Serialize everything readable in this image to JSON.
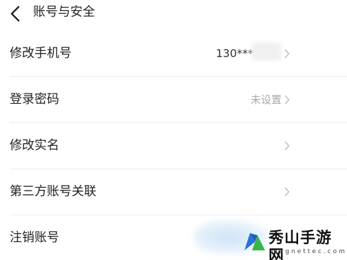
{
  "header": {
    "title": "账号与安全",
    "back_icon": "chevron-left-icon"
  },
  "rows": [
    {
      "label": "修改手机号",
      "value": "130****"
    },
    {
      "label": "登录密码",
      "value": "未设置"
    },
    {
      "label": "修改实名",
      "value": ""
    },
    {
      "label": "第三方账号关联",
      "value": ""
    },
    {
      "label": "注销账号",
      "value": ""
    }
  ],
  "watermark": {
    "brand": "秀山手游网",
    "domain": "magnettec.com",
    "logo_colors": {
      "left": "#2a72d9",
      "right": "#3ab54a"
    }
  },
  "colors": {
    "text": "#222222",
    "muted": "#a9a9a9",
    "chevron": "#bdbdbd",
    "divider": "#ececec"
  }
}
